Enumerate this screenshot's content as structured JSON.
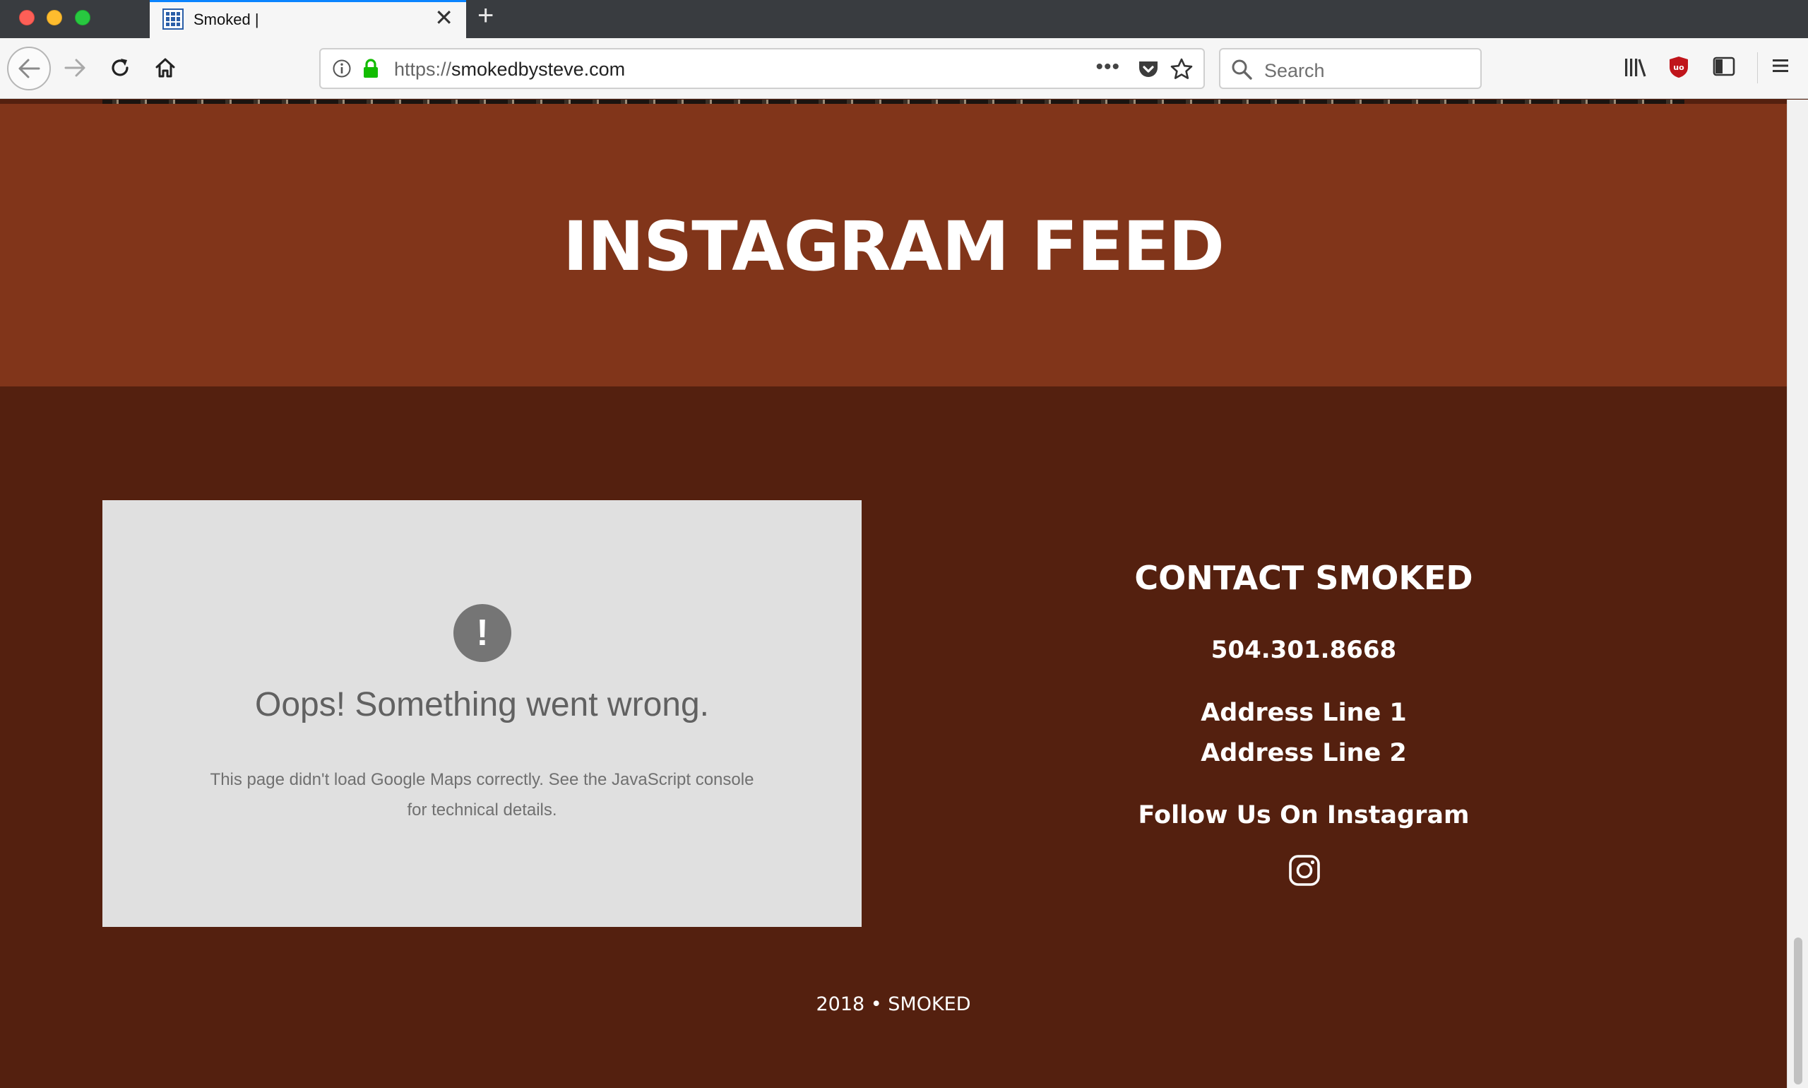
{
  "browser": {
    "tab": {
      "title": "Smoked |",
      "close": "✕"
    },
    "new_tab": "+",
    "url": {
      "protocol": "https://",
      "host": "smokedbysteve.com"
    },
    "url_more": "•••",
    "search_placeholder": "Search"
  },
  "page": {
    "instagram_heading": "INSTAGRAM FEED",
    "map_error": {
      "alert_glyph": "!",
      "heading": "Oops! Something went wrong.",
      "message": "This page didn't load Google Maps correctly. See the JavaScript console for technical details."
    },
    "contact": {
      "title": "CONTACT SMOKED",
      "phone": "504.301.8668",
      "address_line_1": "Address Line 1",
      "address_line_2": "Address Line 2",
      "follow": "Follow Us On Instagram",
      "social_icon": "instagram-icon"
    },
    "footer": "2018 • SMOKED"
  },
  "colors": {
    "instagram_band": "#81351a",
    "footer_bg": "#54200f",
    "map_bg": "#e0e0e0",
    "tab_accent": "#0a84ff",
    "lock_green": "#12bc00",
    "ublock_red": "#c0151b"
  }
}
